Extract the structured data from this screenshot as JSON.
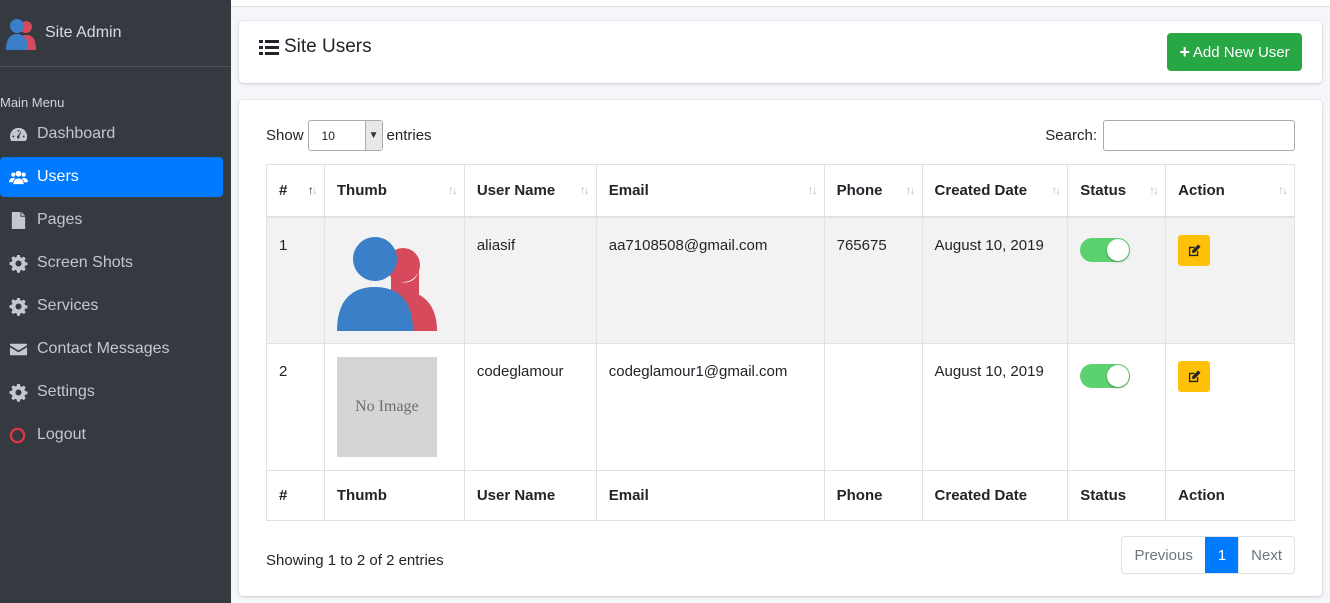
{
  "sidebar": {
    "brand": "Site Admin",
    "menu_header": "Main Menu",
    "items": [
      {
        "label": "Dashboard",
        "icon": "tachometer-icon"
      },
      {
        "label": "Users",
        "icon": "users-icon",
        "active": true
      },
      {
        "label": "Pages",
        "icon": "file-icon"
      },
      {
        "label": "Screen Shots",
        "icon": "gear-icon"
      },
      {
        "label": "Services",
        "icon": "gear-icon"
      },
      {
        "label": "Contact Messages",
        "icon": "envelope-icon"
      },
      {
        "label": "Settings",
        "icon": "gear-icon"
      },
      {
        "label": "Logout",
        "icon": "circle-icon",
        "icon_color": "#dc3545"
      }
    ]
  },
  "header": {
    "title": "Site Users",
    "add_button": "Add New User"
  },
  "table_controls": {
    "show_label": "Show",
    "entries_label": "entries",
    "page_length": "10",
    "search_label": "Search:",
    "search_value": ""
  },
  "table": {
    "columns": [
      "#",
      "Thumb",
      "User Name",
      "Email",
      "Phone",
      "Created Date",
      "Status",
      "Action"
    ],
    "rows": [
      {
        "num": "1",
        "thumb": "avatar",
        "username": "aliasif",
        "email": "aa7108508@gmail.com",
        "phone": "765675",
        "created": "August 10, 2019",
        "status": "on"
      },
      {
        "num": "2",
        "thumb": "No Image",
        "username": "codeglamour",
        "email": "codeglamour1@gmail.com",
        "phone": "",
        "created": "August 10, 2019",
        "status": "on"
      }
    ]
  },
  "footer": {
    "info": "Showing 1 to 2 of 2 entries",
    "previous": "Previous",
    "current_page": "1",
    "next": "Next"
  },
  "colors": {
    "sidebar_bg": "#343a40",
    "active_bg": "#007bff",
    "add_button": "#28a745",
    "edit_button": "#ffc107",
    "toggle_on": "#5cd16f"
  }
}
